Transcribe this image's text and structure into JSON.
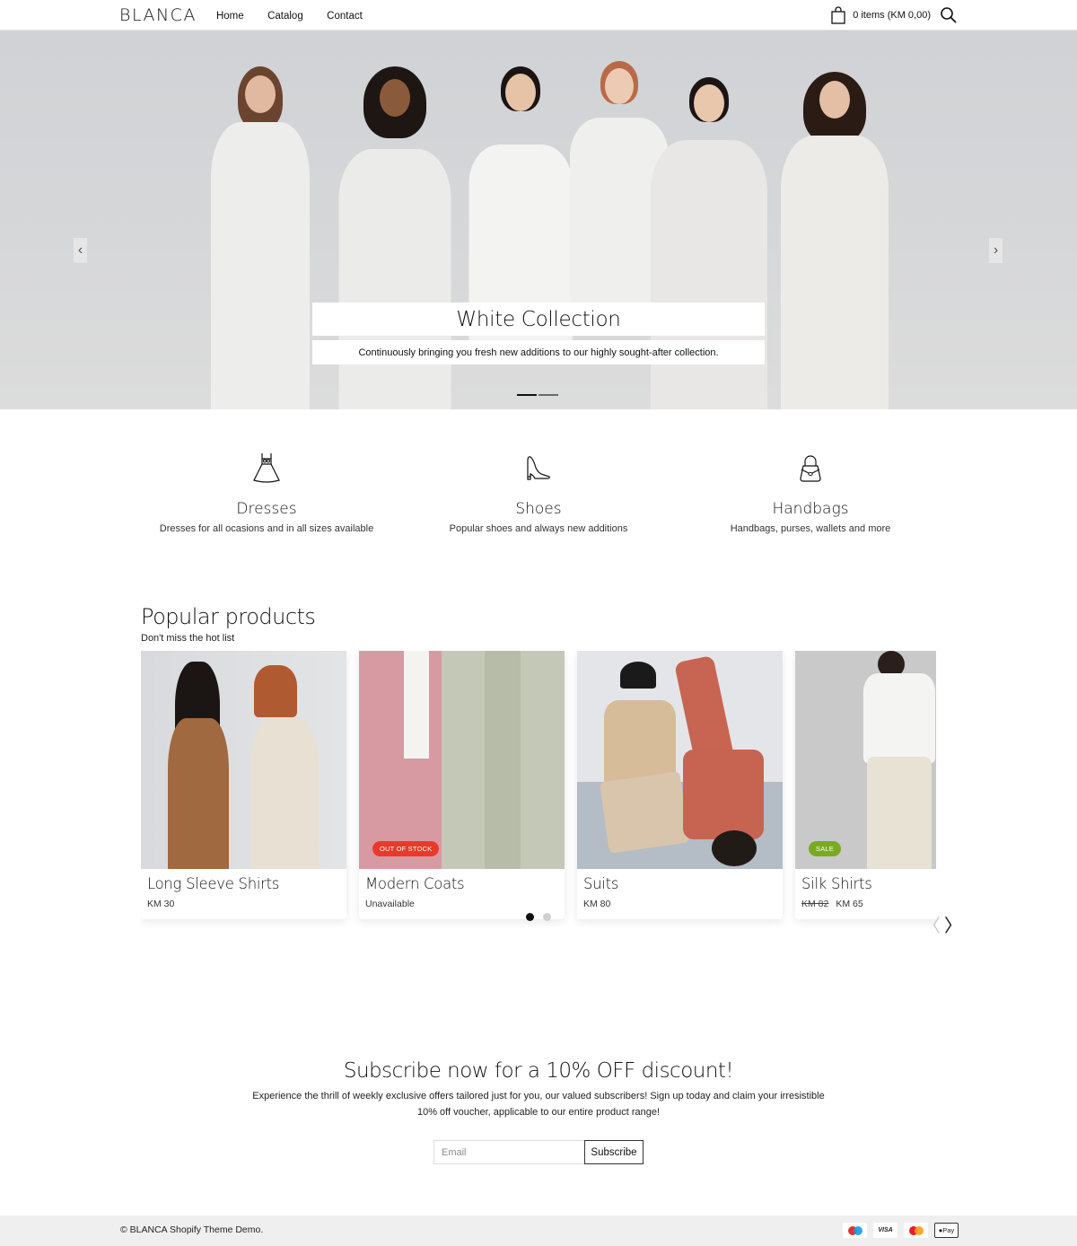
{
  "header": {
    "logo": "BLANCA",
    "nav": [
      {
        "label": "Home"
      },
      {
        "label": "Catalog"
      },
      {
        "label": "Contact"
      }
    ],
    "cart_text": "0 items (KM 0,00)",
    "icons": {
      "cart": "shopping-bag-icon",
      "search": "search-icon"
    }
  },
  "hero": {
    "title": "White Collection",
    "subtitle": "Continuously bringing you fresh new additions to our highly sought-after collection.",
    "prev_arrow": "‹",
    "next_arrow": "›",
    "slides": 2,
    "active_slide": 1
  },
  "categories": [
    {
      "title": "Dresses",
      "description": "Dresses for all ocasions and in all sizes available",
      "icon": "dress-icon"
    },
    {
      "title": "Shoes",
      "description": "Popular shoes and always new additions",
      "icon": "high-heel-icon"
    },
    {
      "title": "Handbags",
      "description": "Handbags, purses, wallets and more",
      "icon": "handbag-icon"
    }
  ],
  "popular": {
    "title": "Popular products",
    "subtitle": "Don't miss the hot list",
    "products": [
      {
        "title": "Long Sleeve Shirts",
        "price": "KM 30",
        "old_price": null,
        "badge": null
      },
      {
        "title": "Modern Coats",
        "price": "Unavailable",
        "old_price": null,
        "badge": "OUT OF STOCK"
      },
      {
        "title": "Suits",
        "price": "KM 80",
        "old_price": null,
        "badge": null
      },
      {
        "title": "Silk Shirts",
        "price": "KM 65",
        "old_price": "KM 82",
        "badge": "SALE"
      }
    ],
    "pages": 2,
    "active_page": 1,
    "prev_arrow": "〈",
    "next_arrow": "〉"
  },
  "subscribe": {
    "title": "Subscribe now for a 10% OFF discount!",
    "text": "Experience the thrill of weekly exclusive offers tailored just for you, our valued subscribers! Sign up today and claim your irresistible 10% off voucher, applicable to our entire product range!",
    "email_placeholder": "Email",
    "button_label": "Subscribe"
  },
  "footer": {
    "copyright": "© BLANCA Shopify Theme Demo.",
    "payments": [
      {
        "name": "maestro",
        "label": ""
      },
      {
        "name": "visa",
        "label": "VISA"
      },
      {
        "name": "mastercard",
        "label": ""
      },
      {
        "name": "apple-pay",
        "label": "Pay"
      }
    ]
  },
  "colors": {
    "out_of_stock_badge": "#e8392b",
    "sale_badge": "#7aaa1f",
    "footer_bg": "#efefef",
    "hero_bg": "#d3d5d8"
  }
}
